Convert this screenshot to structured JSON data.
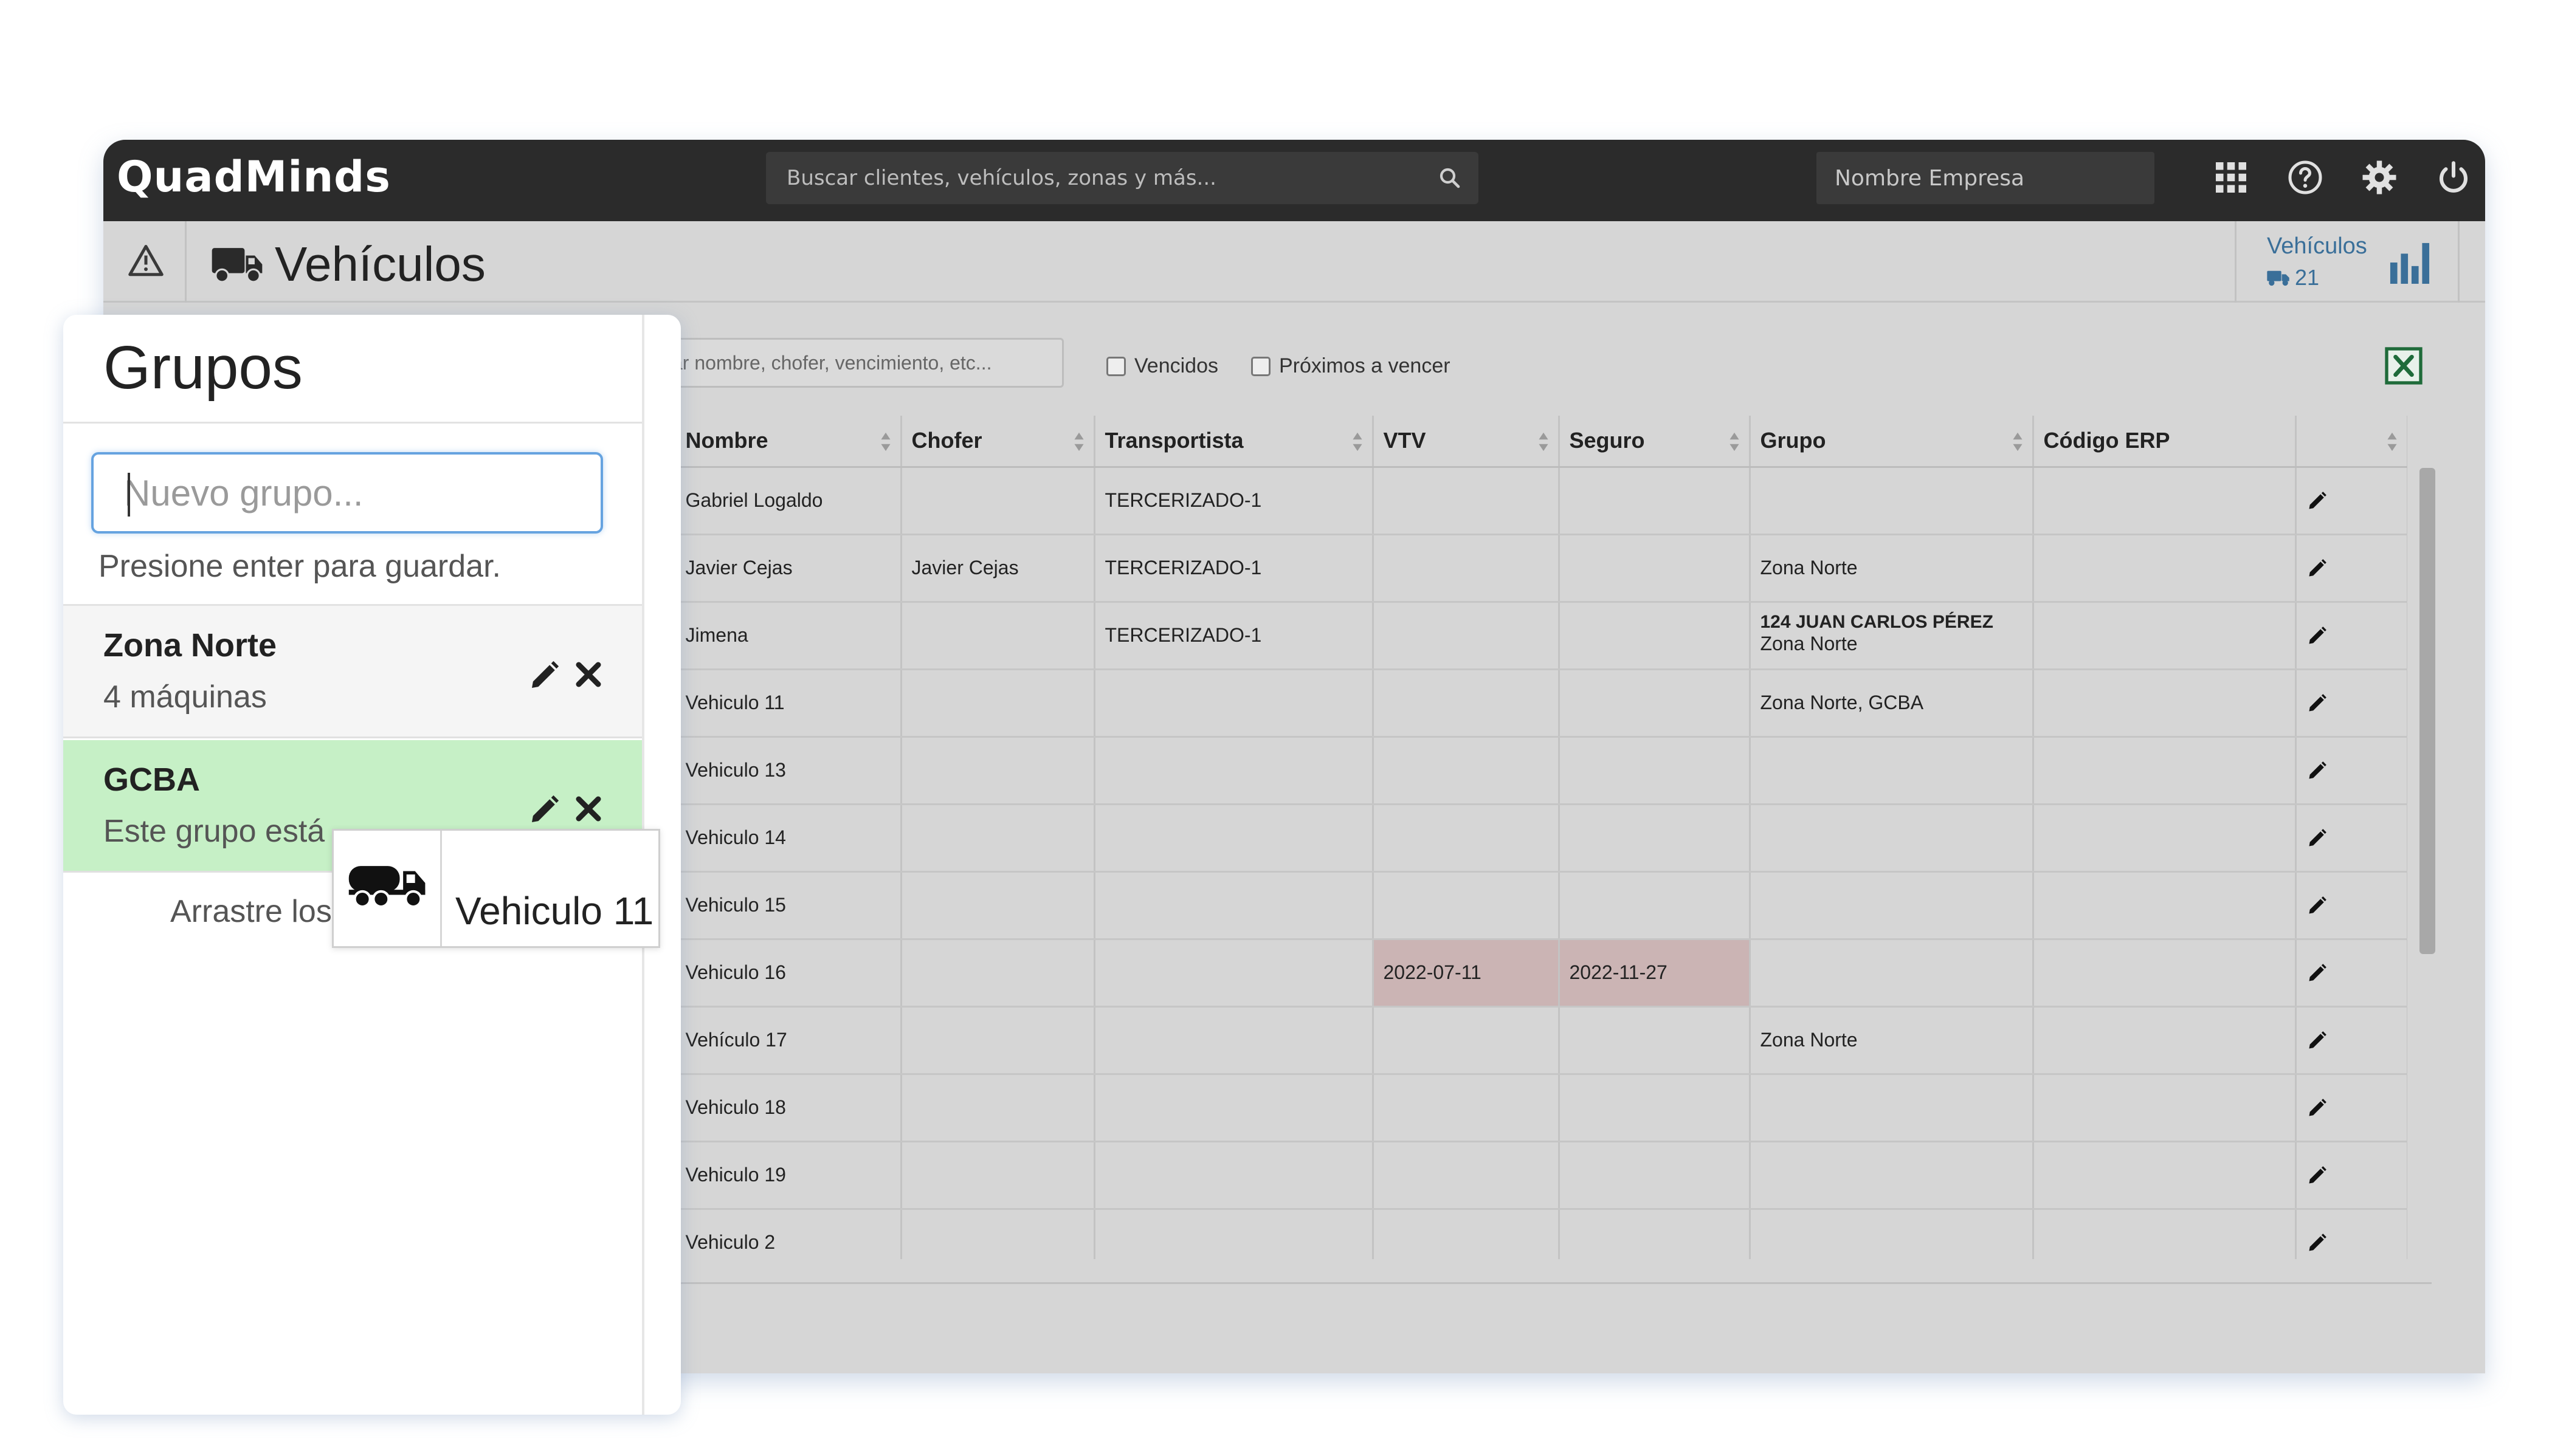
{
  "topbar": {
    "logo": "QuadMinds",
    "search_placeholder": "Buscar clientes, vehículos, zonas y más...",
    "company_placeholder": "Nombre Empresa"
  },
  "header": {
    "title": "Vehículos",
    "stats_label": "Vehículos",
    "stats_count": "21"
  },
  "filters": {
    "search_placeholder": "scar nombre, chofer, vencimiento, etc...",
    "expired_label": "Vencidos",
    "expiring_label": "Próximos a vencer"
  },
  "table": {
    "columns": [
      "Nombre",
      "Chofer",
      "Transportista",
      "VTV",
      "Seguro",
      "Grupo",
      "Código ERP"
    ],
    "rows": [
      {
        "nombre": "Gabriel Logaldo",
        "chofer": "",
        "transportista": "TERCERIZADO-1",
        "vtv": "",
        "seguro": "",
        "grupo_top": "",
        "grupo": "",
        "erp": ""
      },
      {
        "nombre": "Javier Cejas",
        "chofer": "Javier Cejas",
        "transportista": "TERCERIZADO-1",
        "vtv": "",
        "seguro": "",
        "grupo_top": "",
        "grupo": "Zona Norte",
        "erp": ""
      },
      {
        "nombre": "Jimena",
        "chofer": "",
        "transportista": "TERCERIZADO-1",
        "vtv": "",
        "seguro": "",
        "grupo_top": "124 JUAN CARLOS PÉREZ",
        "grupo": "Zona Norte",
        "erp": ""
      },
      {
        "nombre": "Vehiculo 11",
        "chofer": "",
        "transportista": "",
        "vtv": "",
        "seguro": "",
        "grupo_top": "",
        "grupo": "Zona Norte, GCBA",
        "erp": ""
      },
      {
        "nombre": "Vehiculo 13",
        "chofer": "",
        "transportista": "",
        "vtv": "",
        "seguro": "",
        "grupo_top": "",
        "grupo": "",
        "erp": ""
      },
      {
        "nombre": "Vehiculo 14",
        "chofer": "",
        "transportista": "",
        "vtv": "",
        "seguro": "",
        "grupo_top": "",
        "grupo": "",
        "erp": ""
      },
      {
        "nombre": "Vehiculo 15",
        "chofer": "",
        "transportista": "",
        "vtv": "",
        "seguro": "",
        "grupo_top": "",
        "grupo": "",
        "erp": ""
      },
      {
        "nombre": "Vehiculo 16",
        "chofer": "",
        "transportista": "",
        "vtv": "2022-07-11",
        "seguro": "2022-11-27",
        "grupo_top": "",
        "grupo": "",
        "erp": ""
      },
      {
        "nombre": "Vehículo 17",
        "chofer": "",
        "transportista": "",
        "vtv": "",
        "seguro": "",
        "grupo_top": "",
        "grupo": "Zona Norte",
        "erp": ""
      },
      {
        "nombre": "Vehiculo 18",
        "chofer": "",
        "transportista": "",
        "vtv": "",
        "seguro": "",
        "grupo_top": "",
        "grupo": "",
        "erp": ""
      },
      {
        "nombre": "Vehiculo 19",
        "chofer": "",
        "transportista": "",
        "vtv": "",
        "seguro": "",
        "grupo_top": "",
        "grupo": "",
        "erp": ""
      },
      {
        "nombre": "Vehiculo 2",
        "chofer": "",
        "transportista": "",
        "vtv": "",
        "seguro": "",
        "grupo_top": "",
        "grupo": "",
        "erp": ""
      }
    ]
  },
  "groups_panel": {
    "title": "Grupos",
    "new_group_placeholder": "Nuevo grupo...",
    "hint": "Presione enter para guardar.",
    "groups": [
      {
        "name": "Zona Norte",
        "subtitle": "4 máquinas"
      },
      {
        "name": "GCBA",
        "subtitle": "Este grupo está"
      }
    ],
    "drag_hint": "Arrastre los"
  },
  "drag_card": {
    "label": "Vehiculo 11"
  },
  "colors": {
    "topbar": "#2b2b2b",
    "accent_blue": "#3a6f99",
    "selected_group": "#c6f0c6",
    "expired_cell": "#cbb4b4",
    "excel_green": "#1f6b3a"
  }
}
